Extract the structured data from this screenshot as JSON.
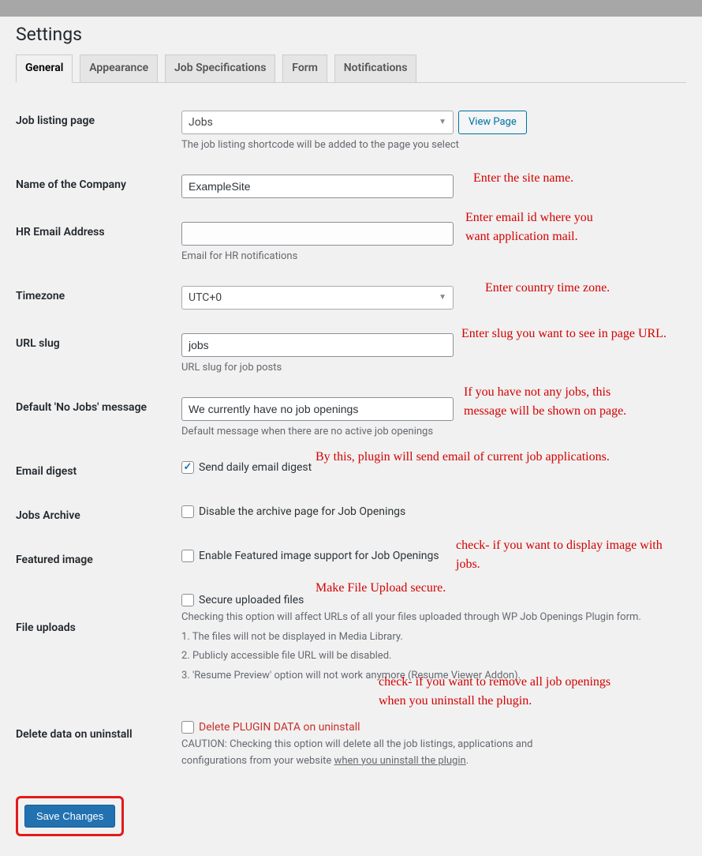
{
  "page_title": "Settings",
  "tabs": [
    "General",
    "Appearance",
    "Job Specifications",
    "Form",
    "Notifications"
  ],
  "active_tab_index": 0,
  "view_page_label": "View Page",
  "fields": {
    "job_listing": {
      "label": "Job listing page",
      "value": "Jobs",
      "description": "The job listing shortcode will be added to the page you select",
      "annotation": ""
    },
    "company_name": {
      "label": "Name of the Company",
      "value": "ExampleSite",
      "annotation": "Enter the site name."
    },
    "hr_email": {
      "label": "HR Email Address",
      "value": "",
      "description": "Email for HR notifications",
      "annotation": "Enter email id where you\nwant application mail."
    },
    "timezone": {
      "label": "Timezone",
      "value": "UTC+0",
      "annotation": "Enter country time zone."
    },
    "url_slug": {
      "label": "URL slug",
      "value": "jobs",
      "description": "URL slug for job posts",
      "annotation": "Enter slug you want to see in page URL."
    },
    "no_jobs": {
      "label": "Default 'No Jobs' message",
      "value": "We currently have no job openings",
      "description": "Default message when there are no active job openings",
      "annotation": "If you have not any jobs, this\nmessage will be shown on page."
    },
    "email_digest": {
      "label": "Email digest",
      "checkbox_label": "Send daily email digest",
      "checked": true,
      "annotation": "By this, plugin will send email of current job applications."
    },
    "jobs_archive": {
      "label": "Jobs Archive",
      "checkbox_label": "Disable the archive page for Job Openings",
      "checked": false
    },
    "featured_image": {
      "label": "Featured image",
      "checkbox_label": "Enable Featured image support for Job Openings",
      "checked": false,
      "annotation": "check- if you want to display image with jobs."
    },
    "file_uploads": {
      "label": "File uploads",
      "checkbox_label": "Secure uploaded files",
      "checked": false,
      "annotation": "Make File Upload secure.",
      "desc_intro": "Checking this option will affect URLs of all your files uploaded through WP Job Openings Plugin form.",
      "desc_1": "1. The files will not be displayed in Media Library.",
      "desc_2": "2. Publicly accessible file URL will be disabled.",
      "desc_3": "3. 'Resume Preview' option will not work anymore (Resume Viewer Addon)."
    },
    "delete_data": {
      "label": "Delete data on uninstall",
      "checkbox_label": "Delete PLUGIN DATA on uninstall",
      "checked": false,
      "annotation": "check- if you want to remove all job openings\nwhen you uninstall the plugin.",
      "caution_pre": "CAUTION: Checking this option will delete all the job listings, applications and configurations from your website ",
      "caution_link": "when you uninstall the plugin"
    }
  },
  "save_button": "Save Changes"
}
